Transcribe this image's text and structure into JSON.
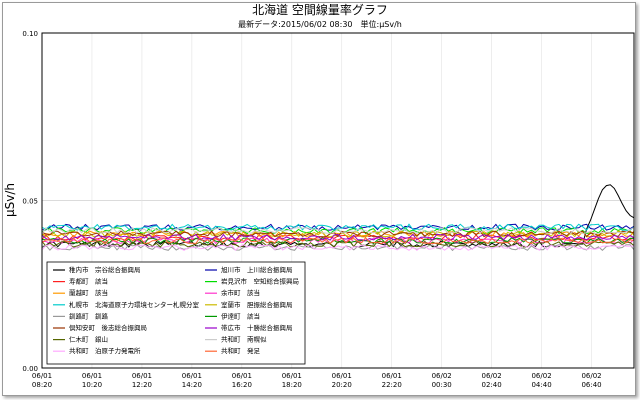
{
  "chart_data": {
    "type": "line",
    "title": "北海道 空間線量率グラフ",
    "subtitle": "最新データ:2015/06/02 08:30　単位:μSv/h",
    "ylabel": "μSv/h",
    "ylim": [
      0.0,
      0.1
    ],
    "yticks": [
      "0.00",
      "0.05",
      "0.10"
    ],
    "x_time_range": [
      "2015-06-01 08:20",
      "2015-06-02 08:30"
    ],
    "xticks": [
      {
        "date": "06/01",
        "time": "08:20"
      },
      {
        "date": "06/01",
        "time": "10:20"
      },
      {
        "date": "06/01",
        "time": "12:20"
      },
      {
        "date": "06/01",
        "time": "14:20"
      },
      {
        "date": "06/01",
        "time": "16:20"
      },
      {
        "date": "06/01",
        "time": "18:20"
      },
      {
        "date": "06/01",
        "time": "20:20"
      },
      {
        "date": "06/01",
        "time": "22:20"
      },
      {
        "date": "06/02",
        "time": "00:30"
      },
      {
        "date": "06/02",
        "time": "02:40"
      },
      {
        "date": "06/02",
        "time": "04:40"
      },
      {
        "date": "06/02",
        "time": "06:40"
      }
    ],
    "grid": true,
    "legend_position": "bottom-left",
    "series": [
      {
        "name": "稚内市　宗谷総合振興局",
        "color": "#000000",
        "base": 0.037,
        "peak": true
      },
      {
        "name": "旭川市　上川総合振興局",
        "color": "#0000aa",
        "base": 0.042
      },
      {
        "name": "寿都町　該当",
        "color": "#ff2020",
        "base": 0.039
      },
      {
        "name": "岩見沢市　空知総合振興局",
        "color": "#00dd00",
        "base": 0.041
      },
      {
        "name": "蘭越町　該当",
        "color": "#ff9900",
        "base": 0.04
      },
      {
        "name": "余市町　該当",
        "color": "#ff33cc",
        "base": 0.038
      },
      {
        "name": "札幌市　北海道原子力環境センター札幌分室",
        "color": "#00cccc",
        "base": 0.042
      },
      {
        "name": "室蘭市　胆振総合振興局",
        "color": "#ccbb00",
        "base": 0.04
      },
      {
        "name": "釧路町　釧路",
        "color": "#999999",
        "base": 0.036
      },
      {
        "name": "伊達町　該当",
        "color": "#009900",
        "base": 0.038
      },
      {
        "name": "倶知安町　後志総合振興局",
        "color": "#993300",
        "base": 0.04
      },
      {
        "name": "帯広市　十勝総合振興局",
        "color": "#9900cc",
        "base": 0.039
      },
      {
        "name": "仁木町　銀山",
        "color": "#556600",
        "base": 0.037
      },
      {
        "name": "共和町　南幌似",
        "color": "#cccccc",
        "base": 0.041
      },
      {
        "name": "共和町　泊原子力発電所",
        "color": "#ffaaff",
        "base": 0.036
      },
      {
        "name": "共和町　発足",
        "color": "#ff6633",
        "base": 0.038
      }
    ]
  }
}
